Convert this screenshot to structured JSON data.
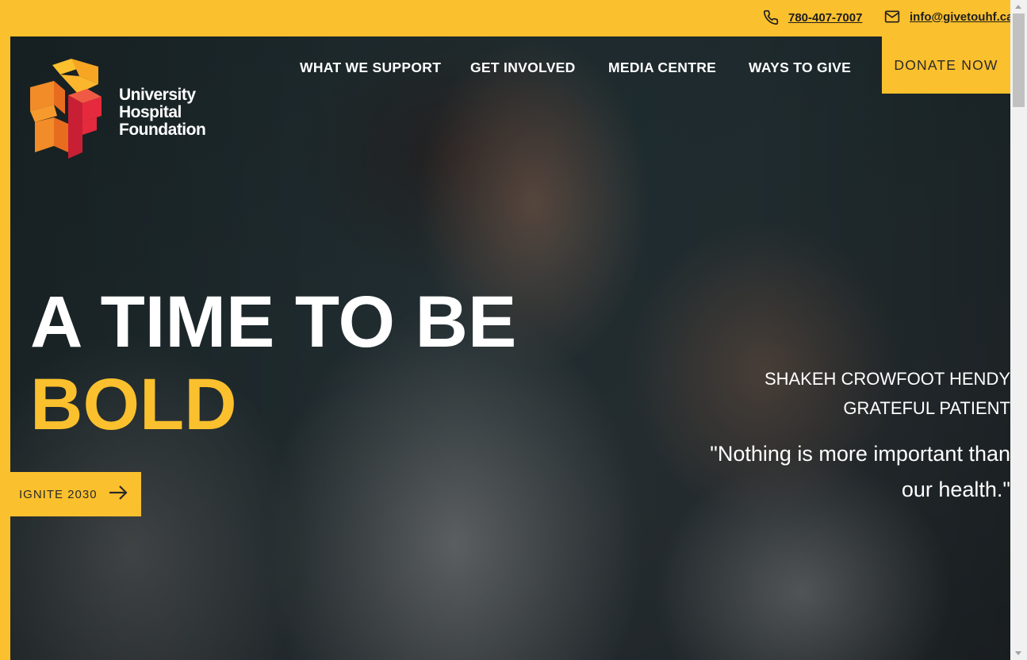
{
  "contact": {
    "phone": "780-407-7007",
    "email": "info@givetouhf.ca"
  },
  "logo": {
    "line1": "University",
    "line2": "Hospital",
    "line3": "Foundation"
  },
  "nav": {
    "items": [
      {
        "label": "WHAT WE SUPPORT"
      },
      {
        "label": "GET INVOLVED"
      },
      {
        "label": "MEDIA CENTRE"
      },
      {
        "label": "WAYS TO GIVE"
      }
    ],
    "donate_label": "DONATE NOW"
  },
  "hero": {
    "headline_line1": "A TIME TO BE",
    "headline_line2": "BOLD",
    "cta_label": "IGNITE 2030",
    "person_name": "SHAKEH CROWFOOT HENDY",
    "person_role": "GRATEFUL PATIENT",
    "quote": "\"Nothing is more important than our health.\""
  },
  "colors": {
    "brand_yellow": "#fbc02d",
    "logo_orange": "#f28c28",
    "logo_red": "#e52a3d",
    "text_dark": "#1e1e1e",
    "text_light": "#ffffff"
  },
  "icons": {
    "phone": "phone-icon",
    "email": "envelope-icon",
    "cta_arrow": "arrow-right-icon"
  }
}
